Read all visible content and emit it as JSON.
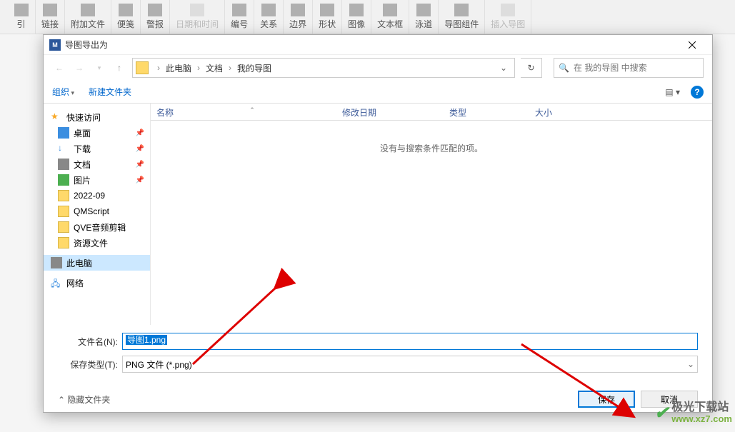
{
  "ribbon": [
    {
      "label": "引",
      "disabled": false
    },
    {
      "label": "链接",
      "disabled": false
    },
    {
      "label": "附加文件",
      "disabled": false
    },
    {
      "label": "便笺",
      "disabled": false
    },
    {
      "label": "警报",
      "disabled": false
    },
    {
      "label": "日期和时间",
      "disabled": true
    },
    {
      "label": "编号",
      "disabled": false
    },
    {
      "label": "关系",
      "disabled": false
    },
    {
      "label": "边界",
      "disabled": false
    },
    {
      "label": "形状",
      "disabled": false
    },
    {
      "label": "图像",
      "disabled": false
    },
    {
      "label": "文本框",
      "disabled": false
    },
    {
      "label": "泳道",
      "disabled": false
    },
    {
      "label": "导图组件",
      "disabled": false
    },
    {
      "label": "插入导图",
      "disabled": true
    }
  ],
  "dialog": {
    "title": "导图导出为",
    "breadcrumbs": [
      "此电脑",
      "文档",
      "我的导图"
    ],
    "search_placeholder": "在 我的导图 中搜索",
    "organize": "组织",
    "newfolder": "新建文件夹",
    "columns": {
      "name": "名称",
      "date": "修改日期",
      "type": "类型",
      "size": "大小"
    },
    "empty": "没有与搜索条件匹配的项。",
    "sidebar": {
      "quick": "快速访问",
      "desktop": "桌面",
      "downloads": "下载",
      "documents": "文档",
      "pictures": "图片",
      "f1": "2022-09",
      "f2": "QMScript",
      "f3": "QVE音频剪辑",
      "f4": "资源文件",
      "thispc": "此电脑",
      "network": "网络"
    },
    "filename_label": "文件名(N):",
    "filename_value": "导图1.png",
    "filetype_label": "保存类型(T):",
    "filetype_value": "PNG 文件 (*.png)",
    "hide_folders": "隐藏文件夹",
    "save": "保存",
    "cancel": "取消"
  },
  "watermark": {
    "cn": "极光下载站",
    "url": "www.xz7.com"
  }
}
